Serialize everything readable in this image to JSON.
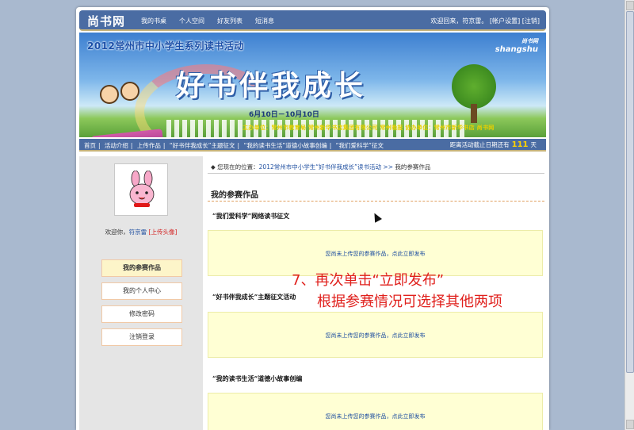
{
  "header": {
    "logo": "尚书网",
    "nav": [
      "我的书桌",
      "个人空间",
      "好友列表",
      "短消息"
    ],
    "welcome_prefix": "欢迎回来，符京雷。",
    "account_settings": "[帐户设置]",
    "logout": "[注销]"
  },
  "banner": {
    "title": "2012常州市中小学生系列读书活动",
    "slogan": "好书伴我成长",
    "date": "6月10日－10月10日",
    "organizers": "主办单位：常州市教育局  常州新华书店集团有限公司  常州晚报    协办单位：常州市新华书店 尚书网",
    "brand_cn": "尚书网",
    "brand_en": "shangshu"
  },
  "subnav": {
    "links": [
      "首页",
      "活动介绍",
      "上传作品",
      "“好书伴我成长”主题征文",
      "“我的读书生活”道德小故事创编",
      "“我们爱科学”征文"
    ],
    "deadline_prefix": "距离活动截止日期还有",
    "deadline_days": "111",
    "deadline_suffix": "天"
  },
  "sidebar": {
    "welcome": "欢迎你，",
    "username": "符京雷",
    "upload_avatar": "[上传头像]",
    "menu": [
      "我的参赛作品",
      "我的个人中心",
      "修改密码",
      "注销登录"
    ]
  },
  "content": {
    "breadcrumb_prefix": "◆ 您现在的位置：",
    "breadcrumb_link": "2012常州市中小学生“好书伴我成长”读书活动",
    "breadcrumb_sep": ">>",
    "breadcrumb_current": "我的参赛作品",
    "title": "我的参赛作品",
    "categories": [
      {
        "name": "“我们爱科学”网络读书征文",
        "notice": "您尚未上传您的参赛作品，点此立即发布"
      },
      {
        "name": "“好书伴我成长”主题征文活动",
        "notice": "您尚未上传您的参赛作品，点此立即发布"
      },
      {
        "name": "“我的读书生活”道德小故事创编",
        "notice": "您尚未上传您的参赛作品，点此立即发布"
      }
    ]
  },
  "annotation": {
    "line1": "7、再次单击“立即发布”",
    "line2": "根据参赛情况可选择其他两项"
  }
}
